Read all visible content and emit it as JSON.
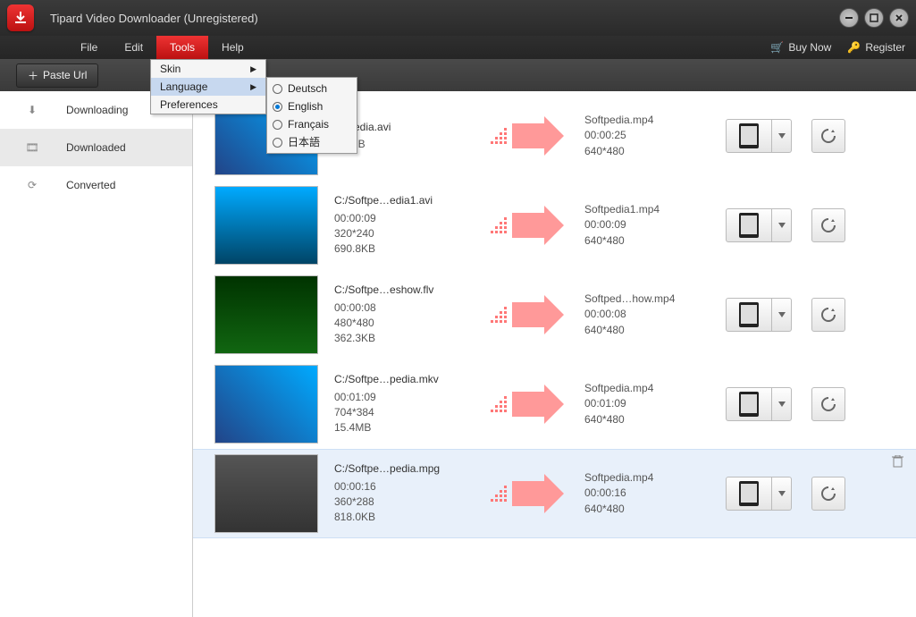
{
  "title": "Tipard Video Downloader (Unregistered)",
  "menu": {
    "file": "File",
    "edit": "Edit",
    "tools": "Tools",
    "help": "Help",
    "skin": "Skin",
    "language": "Language",
    "preferences": "Preferences"
  },
  "languages": [
    "Deutsch",
    "English",
    "Français",
    "日本語"
  ],
  "selected_language": "English",
  "links": {
    "buy": "Buy Now",
    "register": "Register"
  },
  "paste": "Paste Url",
  "sidebar": {
    "downloading": "Downloading",
    "downloaded": "Downloaded",
    "converted": "Converted"
  },
  "rows": [
    {
      "src_name": "…tpedia.avi",
      "src_dur": "",
      "src_res": "",
      "src_size": "3.7MB",
      "src_res_line": "",
      "dst_name": "Softpedia.mp4",
      "dst_dur": "00:00:25",
      "dst_res": "640*480"
    },
    {
      "src_name": "C:/Softpe…edia1.avi",
      "src_dur": "00:00:09",
      "src_res": "320*240",
      "src_size": "690.8KB",
      "dst_name": "Softpedia1.mp4",
      "dst_dur": "00:00:09",
      "dst_res": "640*480"
    },
    {
      "src_name": "C:/Softpe…eshow.flv",
      "src_dur": "00:00:08",
      "src_res": "480*480",
      "src_size": "362.3KB",
      "dst_name": "Softped…how.mp4",
      "dst_dur": "00:00:08",
      "dst_res": "640*480"
    },
    {
      "src_name": "C:/Softpe…pedia.mkv",
      "src_dur": "00:01:09",
      "src_res": "704*384",
      "src_size": "15.4MB",
      "dst_name": "Softpedia.mp4",
      "dst_dur": "00:01:09",
      "dst_res": "640*480"
    },
    {
      "src_name": "C:/Softpe…pedia.mpg",
      "src_dur": "00:00:16",
      "src_res": "360*288",
      "src_size": "818.0KB",
      "dst_name": "Softpedia.mp4",
      "dst_dur": "00:00:16",
      "dst_res": "640*480"
    }
  ]
}
